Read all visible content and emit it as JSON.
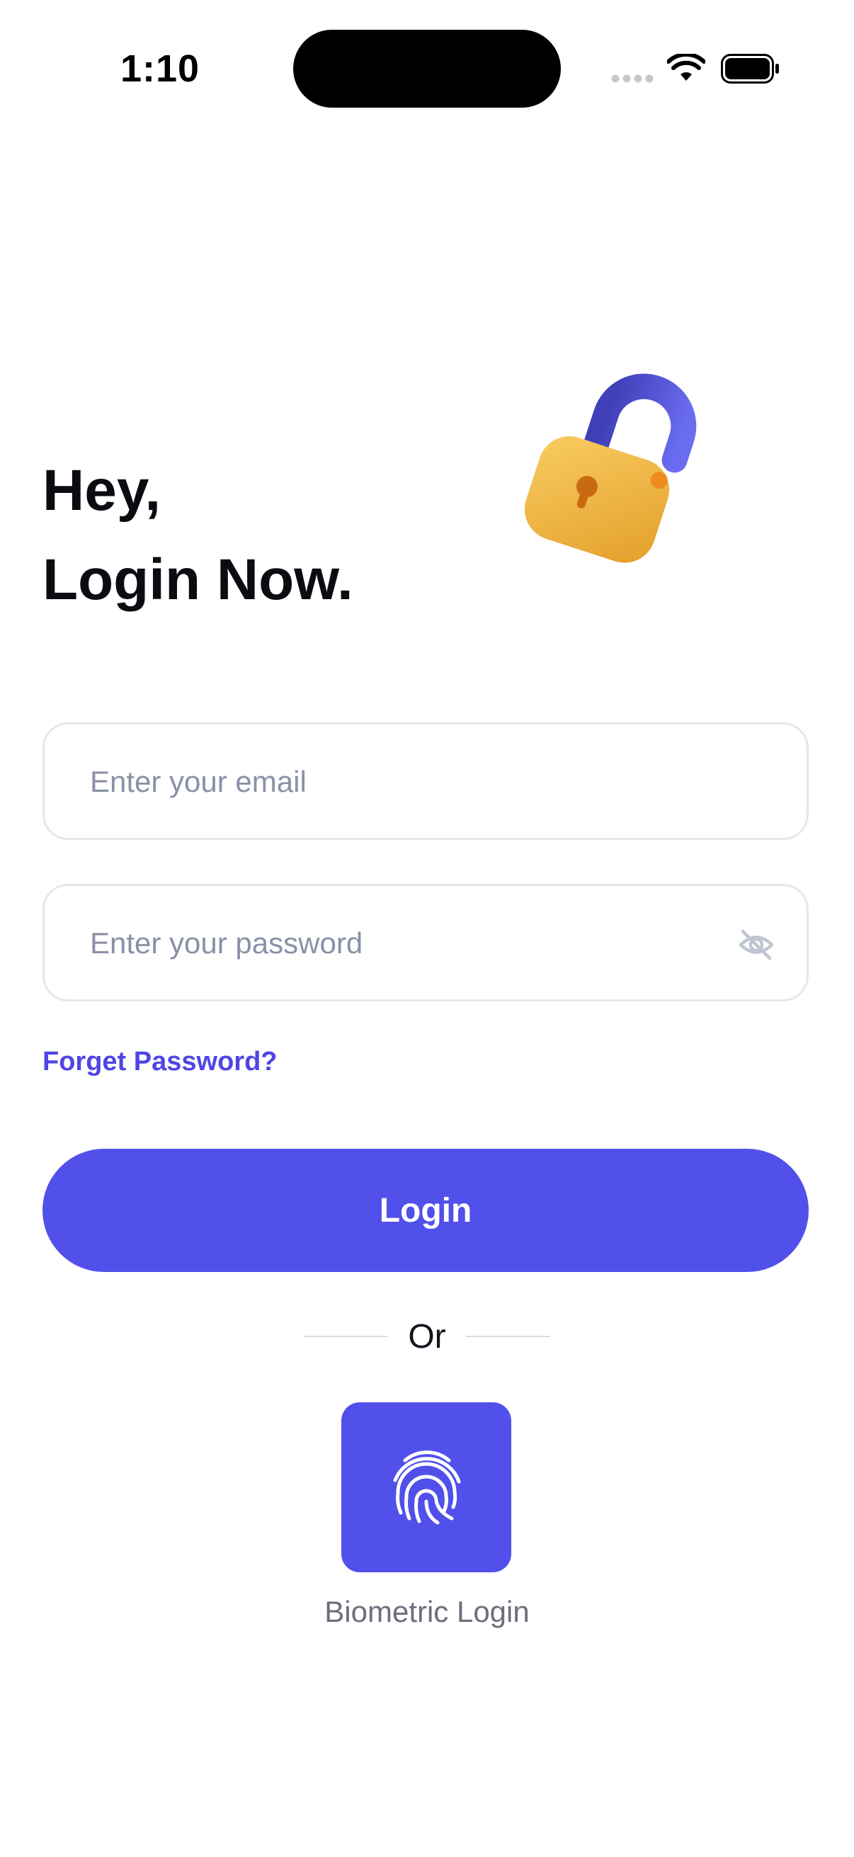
{
  "status_bar": {
    "time": "1:10"
  },
  "header": {
    "line1": "Hey,",
    "line2": "Login Now."
  },
  "form": {
    "email_placeholder": "Enter your email",
    "email_value": "",
    "password_placeholder": "Enter your password",
    "password_value": "",
    "forgot_label": "Forget Password?",
    "login_label": "Login"
  },
  "alternative": {
    "or_label": "Or",
    "biometric_label": "Biometric Login"
  },
  "icons": {
    "illustration": "lock-icon",
    "password_toggle": "eye-off-icon",
    "biometric": "fingerprint-icon"
  },
  "colors": {
    "accent": "#5150ea",
    "link": "#4f46e5",
    "lock_body": "#f2b740",
    "lock_shackle": "#5a5bd6"
  }
}
